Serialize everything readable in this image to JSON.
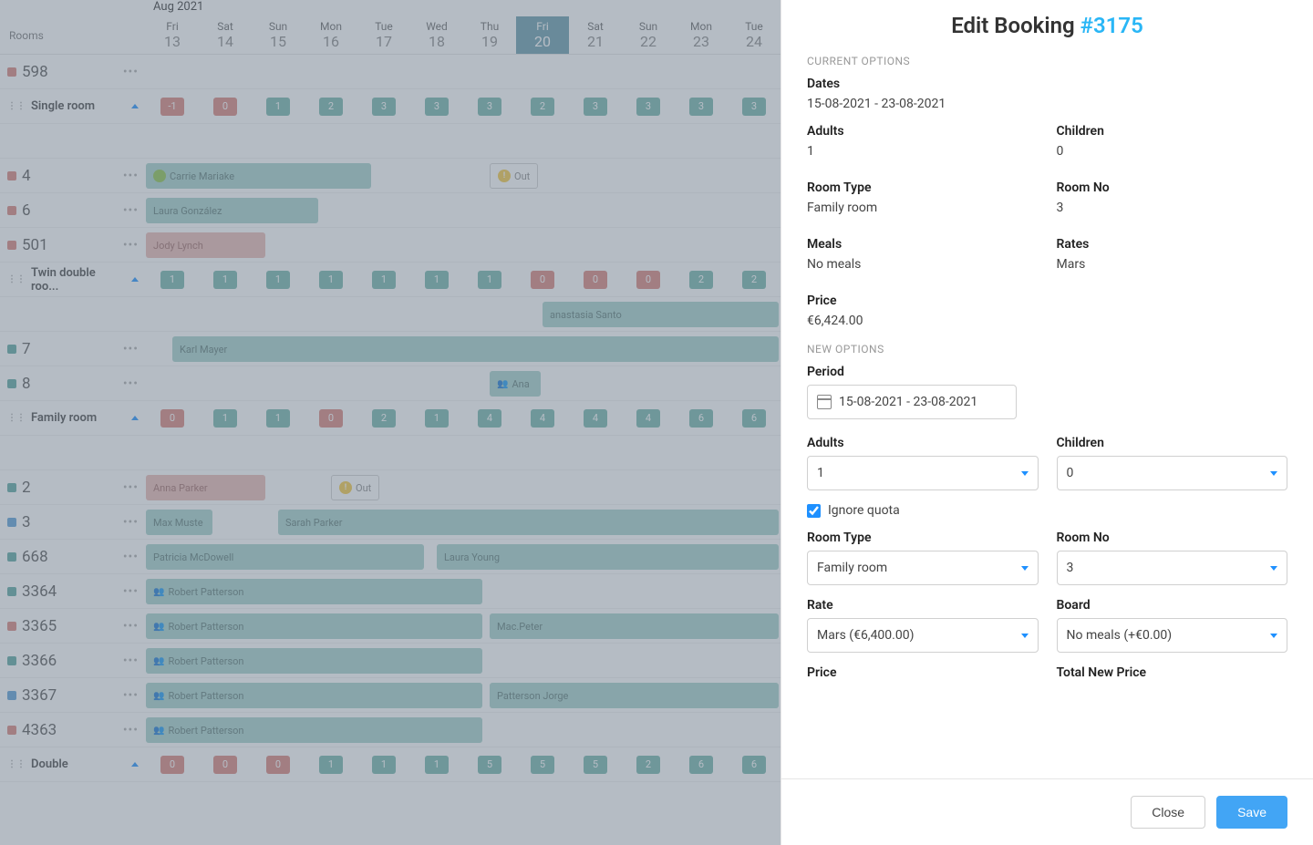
{
  "calendar": {
    "month": "Aug 2021",
    "rooms_label": "Rooms",
    "days": [
      {
        "dow": "Fri",
        "num": "13"
      },
      {
        "dow": "Sat",
        "num": "14"
      },
      {
        "dow": "Sun",
        "num": "15"
      },
      {
        "dow": "Mon",
        "num": "16"
      },
      {
        "dow": "Tue",
        "num": "17"
      },
      {
        "dow": "Wed",
        "num": "18"
      },
      {
        "dow": "Thu",
        "num": "19"
      },
      {
        "dow": "Fri",
        "num": "20",
        "today": true
      },
      {
        "dow": "Sat",
        "num": "21"
      },
      {
        "dow": "Sun",
        "num": "22"
      },
      {
        "dow": "Mon",
        "num": "23"
      },
      {
        "dow": "Tue",
        "num": "24"
      }
    ],
    "rows": [
      {
        "type": "room",
        "color": "red",
        "label": "598"
      },
      {
        "type": "group",
        "label": "Single room",
        "avail": [
          "-1",
          "0",
          "1",
          "2",
          "3",
          "3",
          "3",
          "2",
          "3",
          "3",
          "3",
          "3"
        ],
        "avail_color": [
          "red",
          "red",
          "green",
          "green",
          "green",
          "green",
          "green",
          "green",
          "green",
          "green",
          "green",
          "green"
        ]
      },
      {
        "type": "spacer"
      },
      {
        "type": "room",
        "color": "red",
        "label": "4",
        "bars": [
          {
            "name": "Carrie Mariake",
            "start": 0,
            "span": 4.3,
            "green_dot": true
          }
        ],
        "out": {
          "start": 6.5,
          "text": "Out"
        }
      },
      {
        "type": "room",
        "color": "red",
        "label": "6",
        "bars": [
          {
            "name": "Laura González",
            "start": 0,
            "span": 3.3
          }
        ]
      },
      {
        "type": "room",
        "color": "red",
        "label": "501",
        "bars": [
          {
            "name": "Jody Lynch",
            "start": 0,
            "span": 2.3,
            "pink": true
          }
        ]
      },
      {
        "type": "group",
        "label": "Twin double roo...",
        "avail": [
          "1",
          "1",
          "1",
          "1",
          "1",
          "1",
          "1",
          "0",
          "0",
          "0",
          "2",
          "2"
        ],
        "avail_color": [
          "green",
          "green",
          "green",
          "green",
          "green",
          "green",
          "green",
          "red",
          "red",
          "red",
          "green",
          "green"
        ]
      },
      {
        "type": "spacer",
        "bars": [
          {
            "name": "anastasia Santo",
            "start": 7.5,
            "span": 4.5
          }
        ]
      },
      {
        "type": "room",
        "color": "teal",
        "label": "7",
        "bars": [
          {
            "name": "Karl Mayer",
            "start": 0.5,
            "span": 11.5
          }
        ]
      },
      {
        "type": "room",
        "color": "teal",
        "label": "8",
        "bars": [
          {
            "name": "Ana",
            "start": 6.5,
            "span": 1,
            "people": true
          }
        ]
      },
      {
        "type": "group",
        "label": "Family room",
        "avail": [
          "0",
          "1",
          "1",
          "0",
          "2",
          "1",
          "4",
          "4",
          "4",
          "4",
          "6",
          "6"
        ],
        "avail_color": [
          "red",
          "green",
          "green",
          "red",
          "green",
          "green",
          "green",
          "green",
          "green",
          "green",
          "green",
          "green"
        ]
      },
      {
        "type": "spacer"
      },
      {
        "type": "room",
        "color": "teal",
        "label": "2",
        "bars": [
          {
            "name": "Anna Parker",
            "start": 0,
            "span": 2.3,
            "pink": true
          }
        ],
        "out": {
          "start": 3.5,
          "text": "Out"
        }
      },
      {
        "type": "room",
        "color": "blue",
        "label": "3",
        "bars": [
          {
            "name": "Max Muste",
            "start": 0,
            "span": 1.3
          },
          {
            "name": "Sarah Parker",
            "start": 2.5,
            "span": 9.5
          }
        ]
      },
      {
        "type": "room",
        "color": "teal",
        "label": "668",
        "bars": [
          {
            "name": "Patricia McDowell",
            "start": 0,
            "span": 5.3
          },
          {
            "name": "Laura Young",
            "start": 5.5,
            "span": 6.5
          }
        ]
      },
      {
        "type": "room",
        "color": "teal",
        "label": "3364",
        "bars": [
          {
            "name": "Robert Patterson",
            "start": 0,
            "span": 6.4,
            "people": true
          }
        ]
      },
      {
        "type": "room",
        "color": "red",
        "label": "3365",
        "bars": [
          {
            "name": "Robert Patterson",
            "start": 0,
            "span": 6.4,
            "people": true
          },
          {
            "name": "Mac.Peter",
            "start": 6.5,
            "span": 5.5
          }
        ]
      },
      {
        "type": "room",
        "color": "teal",
        "label": "3366",
        "bars": [
          {
            "name": "Robert Patterson",
            "start": 0,
            "span": 6.4,
            "people": true
          }
        ]
      },
      {
        "type": "room",
        "color": "blue",
        "label": "3367",
        "bars": [
          {
            "name": "Robert Patterson",
            "start": 0,
            "span": 6.4,
            "people": true
          },
          {
            "name": "Patterson Jorge",
            "start": 6.5,
            "span": 5.5
          }
        ]
      },
      {
        "type": "room",
        "color": "red",
        "label": "4363",
        "bars": [
          {
            "name": "Robert Patterson",
            "start": 0,
            "span": 6.4,
            "people": true
          }
        ]
      },
      {
        "type": "group",
        "label": "Double",
        "avail": [
          "0",
          "0",
          "0",
          "1",
          "1",
          "1",
          "5",
          "5",
          "5",
          "2",
          "6",
          "6"
        ],
        "avail_color": [
          "red",
          "red",
          "red",
          "green",
          "green",
          "green",
          "green",
          "green",
          "green",
          "green",
          "green",
          "green"
        ]
      }
    ]
  },
  "panel": {
    "title_prefix": "Edit Booking ",
    "booking_id": "#3175",
    "current_label": "CURRENT OPTIONS",
    "new_label": "NEW OPTIONS",
    "dates_label": "Dates",
    "dates_value": "15-08-2021 - 23-08-2021",
    "adults_label": "Adults",
    "adults_value": "1",
    "children_label": "Children",
    "children_value": "0",
    "roomtype_label": "Room Type",
    "roomtype_value": "Family room",
    "roomno_label": "Room No",
    "roomno_value": "3",
    "meals_label": "Meals",
    "meals_value": "No meals",
    "rates_label": "Rates",
    "rates_value": "Mars",
    "price_label": "Price",
    "price_value": "€6,424.00",
    "period_label": "Period",
    "period_input": "15-08-2021 - 23-08-2021",
    "adults_select": "1",
    "children_select": "0",
    "ignore_quota_label": "Ignore quota",
    "roomtype_select": "Family room",
    "roomno_select": "3",
    "rate_label": "Rate",
    "rate_select": "Mars (€6,400.00)",
    "board_label": "Board",
    "board_select": "No meals (+€0.00)",
    "price2_label": "Price",
    "total_label": "Total New Price",
    "close_btn": "Close",
    "save_btn": "Save"
  }
}
